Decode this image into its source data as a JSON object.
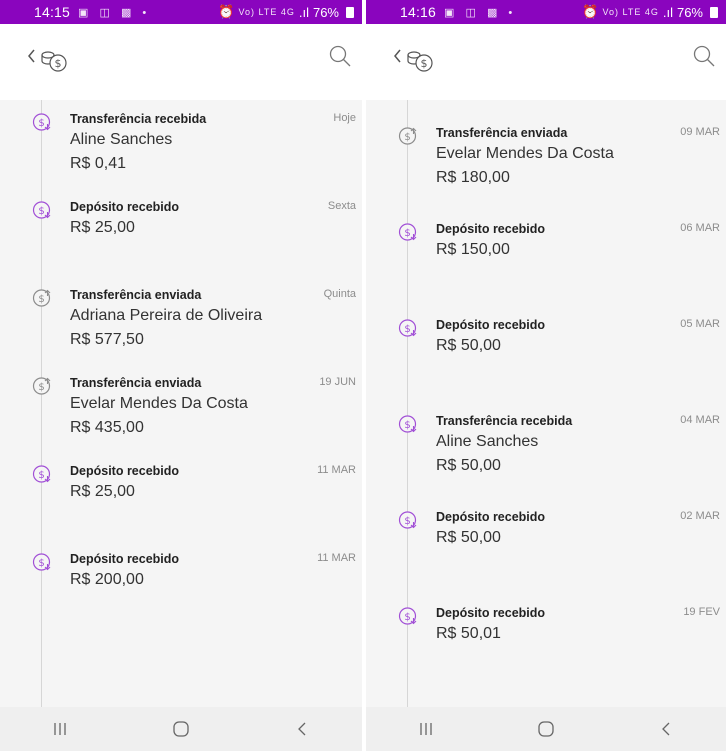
{
  "screens": [
    {
      "status": {
        "time": "14:15",
        "battery": "76%",
        "network": "Vo) LTE 4G"
      },
      "transactions": [
        {
          "title": "Transferência recebida",
          "name": "Aline Sanches",
          "amount": "R$ 0,41",
          "date": "Hoje",
          "direction": "in"
        },
        {
          "title": "Depósito recebido",
          "name": "",
          "amount": "R$ 25,00",
          "date": "Sexta",
          "direction": "in"
        },
        {
          "title": "Transferência enviada",
          "name": "Adriana Pereira de Oliveira",
          "amount": "R$ 577,50",
          "date": "Quinta",
          "direction": "out"
        },
        {
          "title": "Transferência enviada",
          "name": "Evelar Mendes Da Costa",
          "amount": "R$ 435,00",
          "date": "19 JUN",
          "direction": "out"
        },
        {
          "title": "Depósito recebido",
          "name": "",
          "amount": "R$ 25,00",
          "date": "11 MAR",
          "direction": "in"
        },
        {
          "title": "Depósito recebido",
          "name": "",
          "amount": "R$ 200,00",
          "date": "11 MAR",
          "direction": "in"
        }
      ]
    },
    {
      "status": {
        "time": "14:16",
        "battery": "76%",
        "network": "Vo) LTE 4G"
      },
      "transactions": [
        {
          "title": "Transferência enviada",
          "name": "Evelar Mendes Da Costa",
          "amount": "R$ 180,00",
          "date": "09 MAR",
          "direction": "out"
        },
        {
          "title": "Depósito recebido",
          "name": "",
          "amount": "R$ 150,00",
          "date": "06 MAR",
          "direction": "in"
        },
        {
          "title": "Depósito recebido",
          "name": "",
          "amount": "R$ 50,00",
          "date": "05 MAR",
          "direction": "in"
        },
        {
          "title": "Transferência recebida",
          "name": "Aline Sanches",
          "amount": "R$ 50,00",
          "date": "04 MAR",
          "direction": "in"
        },
        {
          "title": "Depósito recebido",
          "name": "",
          "amount": "R$ 50,00",
          "date": "02 MAR",
          "direction": "in"
        },
        {
          "title": "Depósito recebido",
          "name": "",
          "amount": "R$ 50,01",
          "date": "19 FEV",
          "direction": "in"
        }
      ]
    }
  ],
  "colors": {
    "brand": "#8a05be",
    "incoming_icon": "#a14fd6",
    "outgoing_icon": "#8c8c8c"
  },
  "icons": {
    "back": "chevron-left-icon",
    "logo": "coins-icon",
    "search": "search-icon",
    "incoming": "coin-arrow-down-icon",
    "outgoing": "coin-arrow-up-icon",
    "nav_recents": "recents-icon",
    "nav_home": "home-icon",
    "nav_back": "back-icon"
  }
}
